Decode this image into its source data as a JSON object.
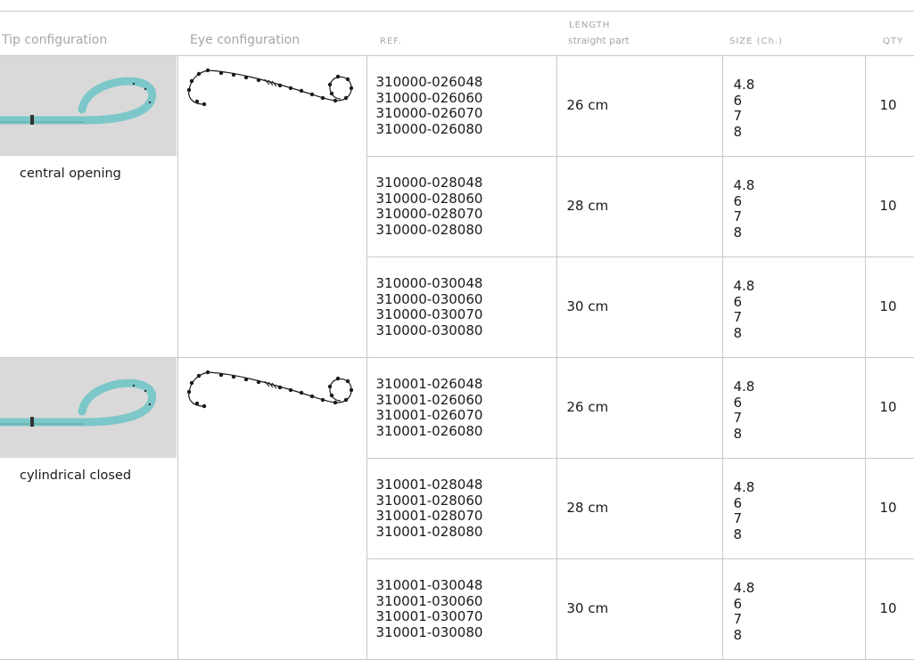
{
  "header": {
    "tip": "Tip configuration",
    "eye": "Eye configuration",
    "ref": "REF.",
    "length": "LENGTH",
    "length_sub": "straight part",
    "size": "SIZE (Ch.)",
    "qty": "QTY"
  },
  "groups": [
    {
      "tip_label": "central opening",
      "rows": [
        {
          "refs": [
            "310000-026048",
            "310000-026060",
            "310000-026070",
            "310000-026080"
          ],
          "length": "26 cm",
          "sizes": [
            "4.8",
            "6",
            "7",
            "8"
          ],
          "qty": "10"
        },
        {
          "refs": [
            "310000-028048",
            "310000-028060",
            "310000-028070",
            "310000-028080"
          ],
          "length": "28 cm",
          "sizes": [
            "4.8",
            "6",
            "7",
            "8"
          ],
          "qty": "10"
        },
        {
          "refs": [
            "310000-030048",
            "310000-030060",
            "310000-030070",
            "310000-030080"
          ],
          "length": "30 cm",
          "sizes": [
            "4.8",
            "6",
            "7",
            "8"
          ],
          "qty": "10"
        }
      ]
    },
    {
      "tip_label": "cylindrical closed",
      "rows": [
        {
          "refs": [
            "310001-026048",
            "310001-026060",
            "310001-026070",
            "310001-026080"
          ],
          "length": "26 cm",
          "sizes": [
            "4.8",
            "6",
            "7",
            "8"
          ],
          "qty": "10"
        },
        {
          "refs": [
            "310001-028048",
            "310001-028060",
            "310001-028070",
            "310001-028080"
          ],
          "length": "28 cm",
          "sizes": [
            "4.8",
            "6",
            "7",
            "8"
          ],
          "qty": "10"
        },
        {
          "refs": [
            "310001-030048",
            "310001-030060",
            "310001-030070",
            "310001-030080"
          ],
          "length": "30 cm",
          "sizes": [
            "4.8",
            "6",
            "7",
            "8"
          ],
          "qty": "10"
        }
      ]
    }
  ],
  "colors": {
    "border": "#c8c8c8",
    "header_text": "#a6a6a6",
    "stent": "#7cc7c9",
    "photo_bg": "#d9d9d9"
  },
  "icons": {
    "tip_photo": "pigtail-stent-tip-photo",
    "eye_diagram": "double-pigtail-eye-diagram"
  }
}
